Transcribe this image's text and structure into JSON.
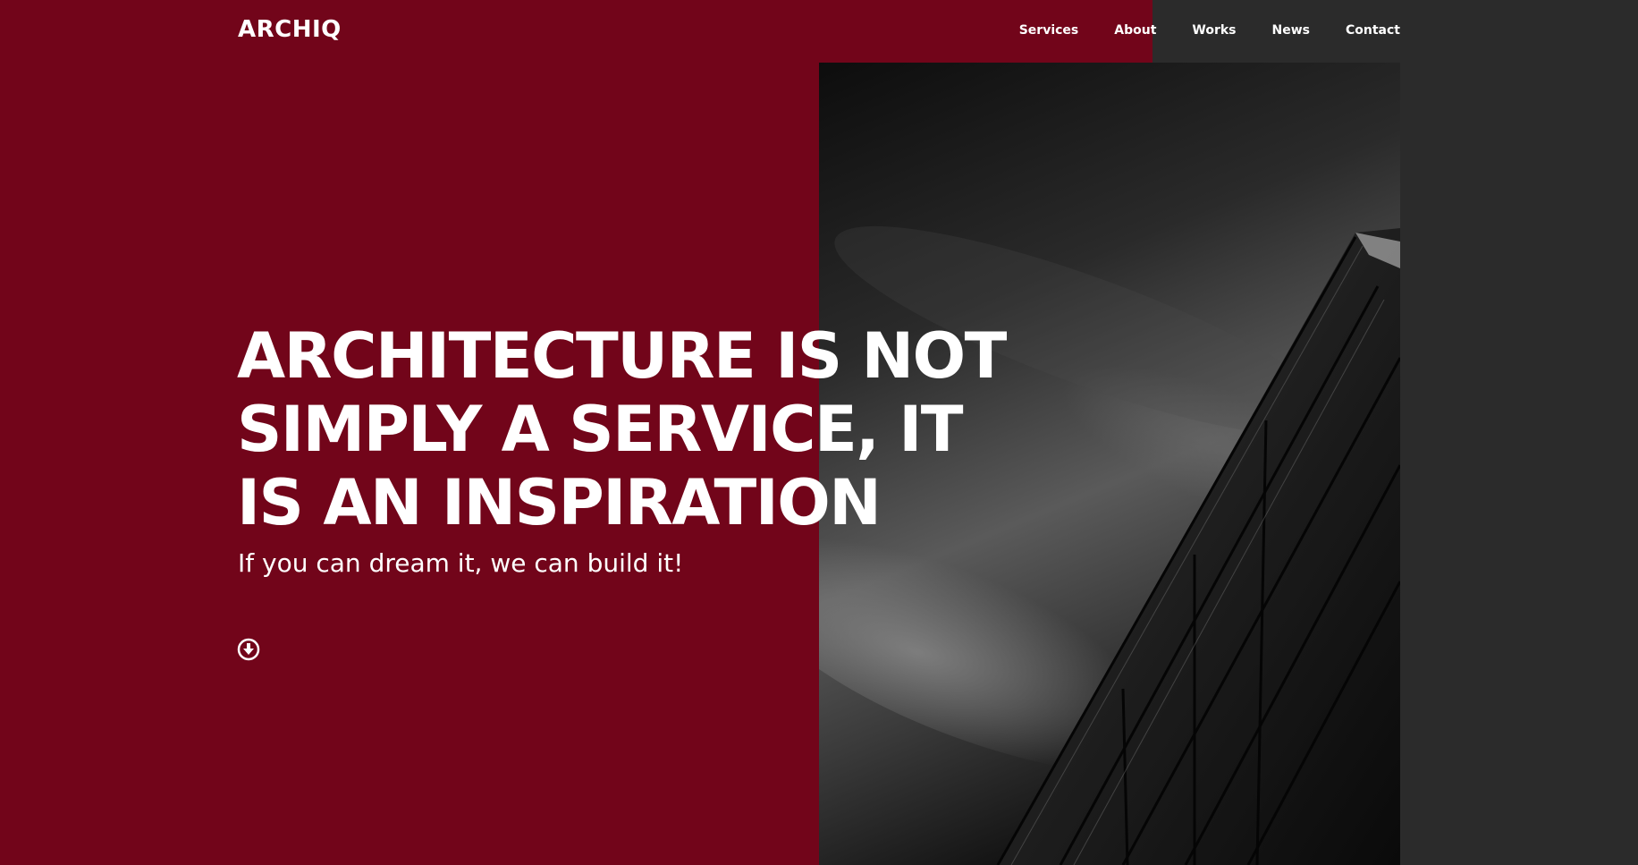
{
  "brand": {
    "logo_text": "ARCHIQ"
  },
  "nav": {
    "items": [
      {
        "label": "Services"
      },
      {
        "label": "About"
      },
      {
        "label": "Works"
      },
      {
        "label": "News"
      },
      {
        "label": "Contact"
      }
    ]
  },
  "hero": {
    "title_lines": [
      "ARCHITECTURE IS NOT",
      "SIMPLY A SERVICE, IT",
      "IS AN INSPIRATION"
    ],
    "subtitle": "If you can dream it, we can build it!",
    "scroll_icon": "arrow-down-circle-icon"
  },
  "colors": {
    "accent_red": "#72051a",
    "dark_panel": "#2b2b2b",
    "text": "#ffffff"
  },
  "image": {
    "subject": "black-and-white-glass-building-photo"
  }
}
